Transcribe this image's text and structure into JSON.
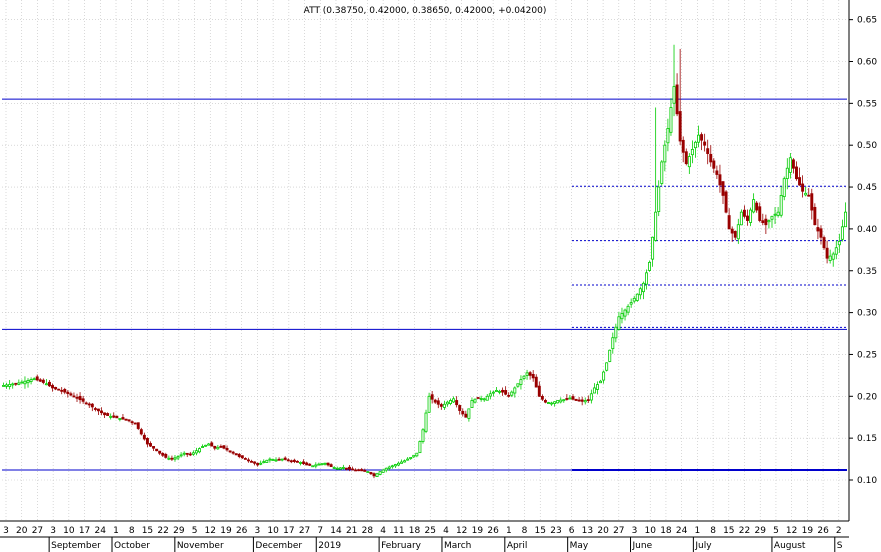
{
  "chart_data": {
    "type": "candlestick",
    "title": "ATT (0.38750, 0.42000, 0.38650, 0.42000, +0.04200)",
    "ylim": [
      0.07,
      0.67
    ],
    "y_ticks": [
      "0.10",
      "0.15",
      "0.20",
      "0.25",
      "0.30",
      "0.35",
      "0.40",
      "0.45",
      "0.50",
      "0.55",
      "0.60",
      "0.65"
    ],
    "x_day_labels": [
      "3",
      "20",
      "27",
      "3",
      "10",
      "17",
      "24",
      "1",
      "8",
      "15",
      "22",
      "29",
      "5",
      "12",
      "19",
      "26",
      "3",
      "10",
      "17",
      "27",
      "7",
      "14",
      "21",
      "28",
      "4",
      "11",
      "18",
      "25",
      "4",
      "12",
      "19",
      "26",
      "1",
      "8",
      "15",
      "23",
      "6",
      "13",
      "20",
      "27",
      "3",
      "10",
      "18",
      "24",
      "1",
      "8",
      "15",
      "22",
      "29",
      "5",
      "12",
      "19",
      "26",
      "2"
    ],
    "x_month_labels": [
      "September",
      "October",
      "November",
      "December",
      "2019",
      "February",
      "March",
      "April",
      "May",
      "June",
      "July",
      "August",
      "S"
    ],
    "grid": true,
    "up_color": "#00cc00",
    "down_color": "#990000",
    "horizontal_lines": [
      {
        "value": 0.555,
        "style": "solid",
        "color": "#0000cc"
      },
      {
        "value": 0.28,
        "style": "solid",
        "color": "#0000cc"
      },
      {
        "value": 0.112,
        "style": "solid",
        "color": "#0000cc"
      }
    ],
    "fib_levels": [
      {
        "value": 0.451,
        "style": "dotted",
        "color": "#0000cc"
      },
      {
        "value": 0.386,
        "style": "dotted",
        "color": "#0000cc"
      },
      {
        "value": 0.333,
        "style": "dotted",
        "color": "#0000cc"
      },
      {
        "value": 0.28,
        "style": "dotted",
        "color": "#0000cc"
      },
      {
        "value": 0.112,
        "style": "dotted",
        "color": "#0000cc"
      }
    ],
    "close_path": [
      [
        0,
        0.213
      ],
      [
        5,
        0.216
      ],
      [
        10,
        0.221
      ],
      [
        14,
        0.215
      ],
      [
        16,
        0.21
      ],
      [
        20,
        0.205
      ],
      [
        24,
        0.198
      ],
      [
        27,
        0.192
      ],
      [
        30,
        0.185
      ],
      [
        33,
        0.178
      ],
      [
        36,
        0.175
      ],
      [
        40,
        0.172
      ],
      [
        43,
        0.168
      ],
      [
        45,
        0.155
      ],
      [
        47,
        0.143
      ],
      [
        49,
        0.138
      ],
      [
        51,
        0.132
      ],
      [
        53,
        0.127
      ],
      [
        55,
        0.125
      ],
      [
        57,
        0.128
      ],
      [
        59,
        0.132
      ],
      [
        61,
        0.13
      ],
      [
        63,
        0.135
      ],
      [
        65,
        0.14
      ],
      [
        67,
        0.143
      ],
      [
        69,
        0.138
      ],
      [
        71,
        0.14
      ],
      [
        73,
        0.136
      ],
      [
        75,
        0.132
      ],
      [
        77,
        0.128
      ],
      [
        79,
        0.125
      ],
      [
        81,
        0.122
      ],
      [
        83,
        0.118
      ],
      [
        85,
        0.122
      ],
      [
        87,
        0.125
      ],
      [
        89,
        0.124
      ],
      [
        91,
        0.125
      ],
      [
        93,
        0.124
      ],
      [
        95,
        0.122
      ],
      [
        97,
        0.121
      ],
      [
        99,
        0.118
      ],
      [
        101,
        0.117
      ],
      [
        103,
        0.119
      ],
      [
        105,
        0.12
      ],
      [
        107,
        0.116
      ],
      [
        109,
        0.114
      ],
      [
        111,
        0.115
      ],
      [
        113,
        0.113
      ],
      [
        115,
        0.112
      ],
      [
        117,
        0.111
      ],
      [
        119,
        0.11
      ],
      [
        121,
        0.105
      ],
      [
        123,
        0.11
      ],
      [
        125,
        0.114
      ],
      [
        127,
        0.117
      ],
      [
        129,
        0.12
      ],
      [
        131,
        0.123
      ],
      [
        133,
        0.127
      ],
      [
        135,
        0.132
      ],
      [
        137,
        0.16
      ],
      [
        139,
        0.2
      ],
      [
        141,
        0.193
      ],
      [
        143,
        0.188
      ],
      [
        145,
        0.193
      ],
      [
        147,
        0.197
      ],
      [
        149,
        0.183
      ],
      [
        151,
        0.175
      ],
      [
        153,
        0.195
      ],
      [
        155,
        0.198
      ],
      [
        157,
        0.197
      ],
      [
        159,
        0.203
      ],
      [
        161,
        0.207
      ],
      [
        163,
        0.205
      ],
      [
        165,
        0.2
      ],
      [
        167,
        0.21
      ],
      [
        169,
        0.22
      ],
      [
        171,
        0.228
      ],
      [
        173,
        0.222
      ],
      [
        175,
        0.2
      ],
      [
        177,
        0.193
      ],
      [
        179,
        0.192
      ],
      [
        181,
        0.195
      ],
      [
        183,
        0.196
      ],
      [
        185,
        0.198
      ],
      [
        187,
        0.195
      ],
      [
        189,
        0.194
      ],
      [
        191,
        0.196
      ],
      [
        193,
        0.21
      ],
      [
        195,
        0.218
      ],
      [
        197,
        0.24
      ],
      [
        199,
        0.27
      ],
      [
        201,
        0.295
      ],
      [
        203,
        0.303
      ],
      [
        205,
        0.312
      ],
      [
        207,
        0.322
      ],
      [
        209,
        0.335
      ],
      [
        211,
        0.36
      ],
      [
        213,
        0.42
      ],
      [
        215,
        0.48
      ],
      [
        217,
        0.52
      ],
      [
        219,
        0.57
      ],
      [
        221,
        0.505
      ],
      [
        223,
        0.478
      ],
      [
        225,
        0.495
      ],
      [
        227,
        0.512
      ],
      [
        229,
        0.5
      ],
      [
        231,
        0.48
      ],
      [
        233,
        0.465
      ],
      [
        235,
        0.44
      ],
      [
        237,
        0.4
      ],
      [
        239,
        0.39
      ],
      [
        241,
        0.42
      ],
      [
        243,
        0.41
      ],
      [
        245,
        0.435
      ],
      [
        247,
        0.41
      ],
      [
        249,
        0.405
      ],
      [
        251,
        0.415
      ],
      [
        253,
        0.42
      ],
      [
        255,
        0.46
      ],
      [
        257,
        0.485
      ],
      [
        259,
        0.46
      ],
      [
        261,
        0.445
      ],
      [
        263,
        0.44
      ],
      [
        265,
        0.405
      ],
      [
        267,
        0.39
      ],
      [
        269,
        0.365
      ],
      [
        271,
        0.37
      ],
      [
        273,
        0.385
      ],
      [
        275,
        0.42
      ]
    ],
    "total_bars": 276
  },
  "colors": {
    "background": "#ffffff",
    "grid": "#c0c0c0",
    "axis": "#000000",
    "line": "#0000cc"
  }
}
